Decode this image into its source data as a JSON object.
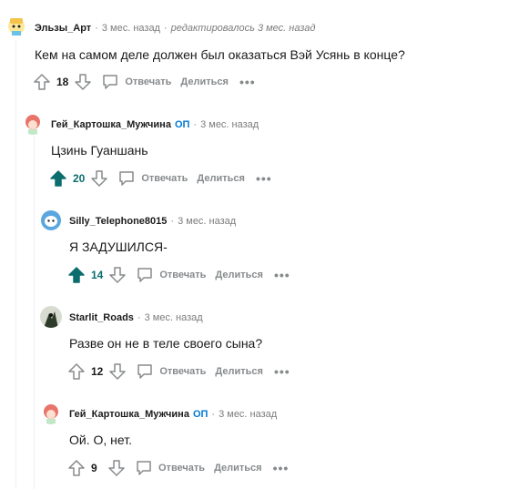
{
  "actions": {
    "reply": "Отвечать",
    "share": "Делиться",
    "more": "•••"
  },
  "badges": {
    "op": "ОП"
  },
  "comments": [
    {
      "author": "Эльзы_Арт",
      "time": "3 мес. назад",
      "edited": "редактировалось 3 мес. назад",
      "text": "Кем на самом деле должен был оказаться Вэй Усянь в конце?",
      "score": "18",
      "upvoted": false
    },
    {
      "author": "Гей_Картошка_Мужчина",
      "op": true,
      "time": "3 мес. назад",
      "text": "Цзинь Гуаншань",
      "score": "20",
      "upvoted": true
    },
    {
      "author": "Silly_Telephone8015",
      "time": "3 мес. назад",
      "text": "Я ЗАДУШИЛСЯ-",
      "score": "14",
      "upvoted": true
    },
    {
      "author": "Starlit_Roads",
      "time": "3 мес. назад",
      "text": "Разве он не в теле своего сына?",
      "score": "12",
      "upvoted": false
    },
    {
      "author": "Гей_Картошка_Мужчина",
      "op": true,
      "time": "3 мес. назад",
      "text": "Ой. О, нет.",
      "score": "9",
      "upvoted": false
    }
  ],
  "colors": {
    "upvote": "#0b6d6d",
    "op": "#0079d3",
    "meta": "#7c7c7c",
    "thread": "#edeff1"
  }
}
